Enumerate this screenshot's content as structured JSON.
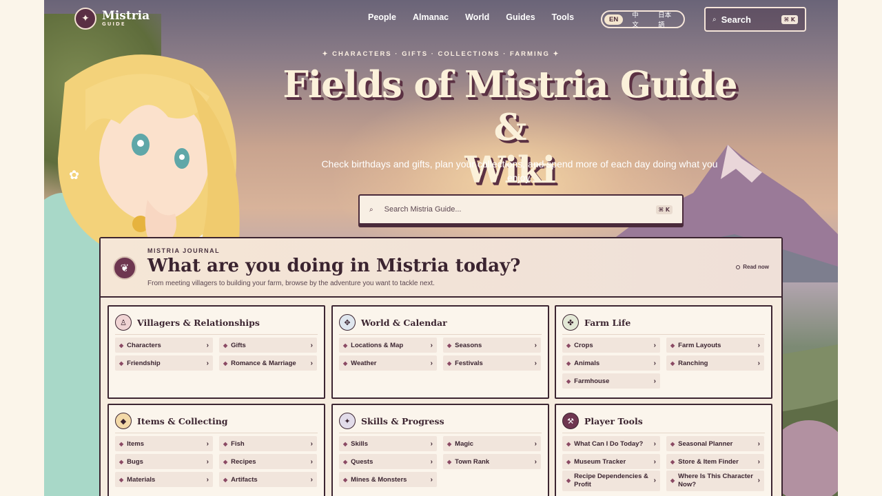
{
  "brand": {
    "name": "Mistria",
    "sub": "GUIDE",
    "mark": "✦"
  },
  "nav": {
    "links": [
      "People",
      "Almanac",
      "World",
      "Guides",
      "Tools"
    ]
  },
  "lang": {
    "options": [
      "EN",
      "中文",
      "日本語"
    ],
    "active": "EN"
  },
  "nav_search": {
    "label": "Search",
    "shortcut": "⌘ K"
  },
  "hero": {
    "eyebrow": "✦ CHARACTERS · GIFTS · COLLECTIONS · FARMING ✦",
    "title_line1": "Fields of Mistria Guide &",
    "title_line2": "Wiki",
    "subtitle": "Check birthdays and gifts, plan your collections, and spend more of each day doing what you enjoy.",
    "search_placeholder": "Search Mistria Guide...",
    "search_shortcut": "⌘ K"
  },
  "journal": {
    "kicker": "MISTRIA JOURNAL",
    "title": "What are you doing in Mistria today?",
    "subtitle": "From meeting villagers to building your farm, browse by the adventure you want to tackle next.",
    "read_now": "Read now",
    "cards": [
      {
        "title": "Villagers & Relationships",
        "icon": "person-icon",
        "glyph": "♙",
        "icon_bg": "#f0d4d4",
        "links": [
          "Characters",
          "Gifts",
          "Friendship",
          "Romance & Marriage"
        ]
      },
      {
        "title": "World & Calendar",
        "icon": "compass-icon",
        "glyph": "✥",
        "icon_bg": "#dfe6ee",
        "links": [
          "Locations & Map",
          "Seasons",
          "Weather",
          "Festivals"
        ]
      },
      {
        "title": "Farm Life",
        "icon": "sprout-icon",
        "glyph": "✤",
        "icon_bg": "#e3e8d6",
        "links": [
          "Crops",
          "Farm Layouts",
          "Animals",
          "Ranching",
          "Farmhouse"
        ]
      },
      {
        "title": "Items & Collecting",
        "icon": "diamond-icon",
        "glyph": "◆",
        "icon_bg": "#f3d9a8",
        "links": [
          "Items",
          "Fish",
          "Bugs",
          "Recipes",
          "Materials",
          "Artifacts"
        ]
      },
      {
        "title": "Skills & Progress",
        "icon": "sparkle-icon",
        "glyph": "✦",
        "icon_bg": "#e2dcea",
        "links": [
          "Skills",
          "Magic",
          "Quests",
          "Town Rank",
          "Mines & Monsters"
        ]
      },
      {
        "title": "Player Tools",
        "icon": "tools-icon",
        "glyph": "⚒",
        "icon_bg": "#6e3650",
        "links": [
          "What Can I Do Today?",
          "Seasonal Planner",
          "Museum Tracker",
          "Store & Item Finder",
          "Recipe Dependencies & Profit",
          "Where Is This Character Now?"
        ]
      }
    ]
  },
  "colors": {
    "accent": "#6e3650",
    "ink": "#3b2430",
    "paper": "#fbf5ec"
  }
}
